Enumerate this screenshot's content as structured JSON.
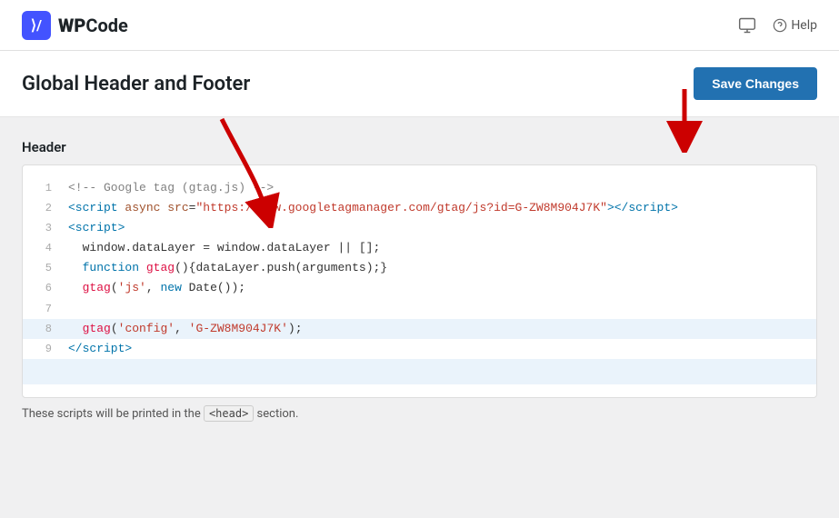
{
  "topbar": {
    "logo_icon": "⟩/",
    "logo_wp": "WP",
    "logo_code": "Code",
    "help_label": "Help"
  },
  "page": {
    "title": "Global Header and Footer",
    "save_button": "Save Changes"
  },
  "header_section": {
    "label": "Header"
  },
  "code": {
    "lines": [
      {
        "num": "1",
        "html": "comment",
        "content": "<!-- Google tag (gtag.js) -->"
      },
      {
        "num": "2",
        "html": "tag-line",
        "content": "<script async src=\"https://www.googletagmanager.com/gtag/js?id=G-ZW8M904J7K\"><\\/script>"
      },
      {
        "num": "3",
        "html": "tag",
        "content": "<script>"
      },
      {
        "num": "4",
        "html": "plain",
        "content": "  window.dataLayer = window.dataLayer || [];"
      },
      {
        "num": "5",
        "html": "plain",
        "content": "  function gtag(){dataLayer.push(arguments);}"
      },
      {
        "num": "6",
        "html": "plain",
        "content": "  gtag('js', new Date());"
      },
      {
        "num": "7",
        "html": "empty",
        "content": ""
      },
      {
        "num": "8",
        "html": "plain-highlight",
        "content": "  gtag('config', 'G-ZW8M904J7K');"
      },
      {
        "num": "9",
        "html": "tag-end",
        "content": "<\\/script>"
      }
    ]
  },
  "footer_note": {
    "text_before": "These scripts will be printed in the ",
    "code": "<head>",
    "text_after": " section."
  }
}
